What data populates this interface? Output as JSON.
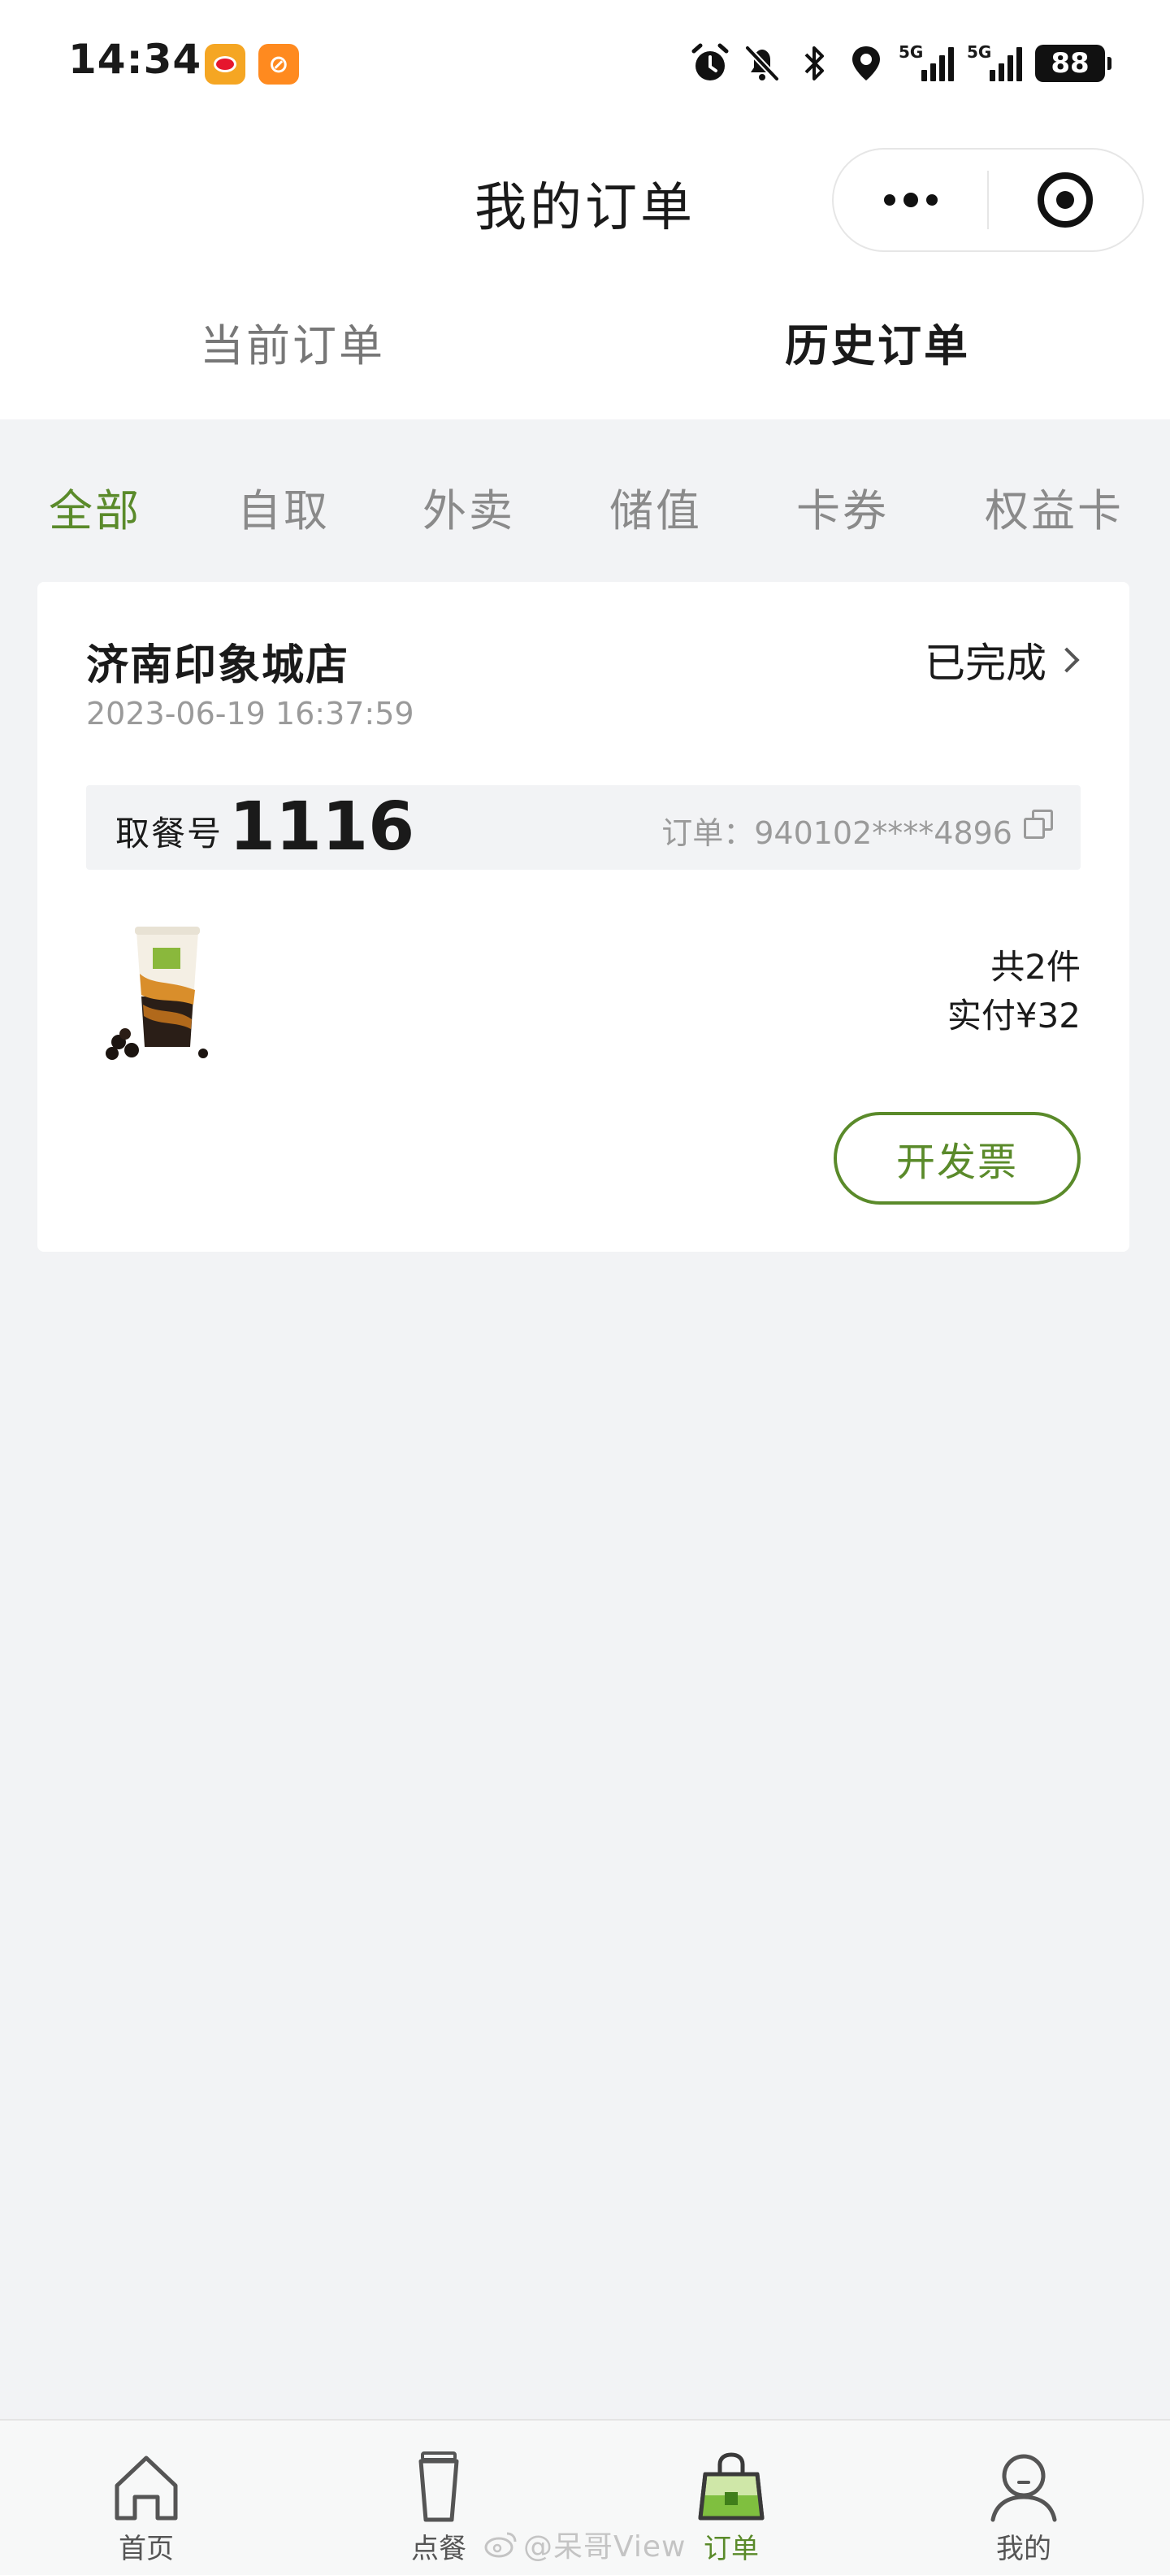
{
  "status_bar": {
    "time": "14:34",
    "notes_app_glyph": "⊘",
    "network_1": "5G",
    "network_2": "5G",
    "battery": "88"
  },
  "header": {
    "title": "我的订单"
  },
  "order_tabs": [
    {
      "label": "当前订单",
      "active": false
    },
    {
      "label": "历史订单",
      "active": true
    }
  ],
  "filters": [
    {
      "label": "全部",
      "active": true
    },
    {
      "label": "自取",
      "active": false
    },
    {
      "label": "外卖",
      "active": false
    },
    {
      "label": "储值",
      "active": false
    },
    {
      "label": "卡券",
      "active": false
    },
    {
      "label": "权益卡",
      "active": false
    }
  ],
  "order": {
    "store_name": "济南印象城店",
    "status": "已完成",
    "time": "2023-06-19 16:37:59",
    "pickup_label": "取餐号",
    "pickup_number": "1116",
    "order_no": "订单：940102****4896",
    "quantity": "共2件",
    "paid": "实付¥32",
    "invoice_label": "开发票"
  },
  "tab_bar": [
    {
      "label": "首页",
      "icon": "home-icon",
      "active": false
    },
    {
      "label": "点餐",
      "icon": "cup-icon",
      "active": false
    },
    {
      "label": "订单",
      "icon": "bag-icon",
      "active": true
    },
    {
      "label": "我的",
      "icon": "person-icon",
      "active": false
    }
  ],
  "watermark": "@呆哥View",
  "colors": {
    "accent": "#5a8a2a",
    "background": "#f2f3f5"
  }
}
